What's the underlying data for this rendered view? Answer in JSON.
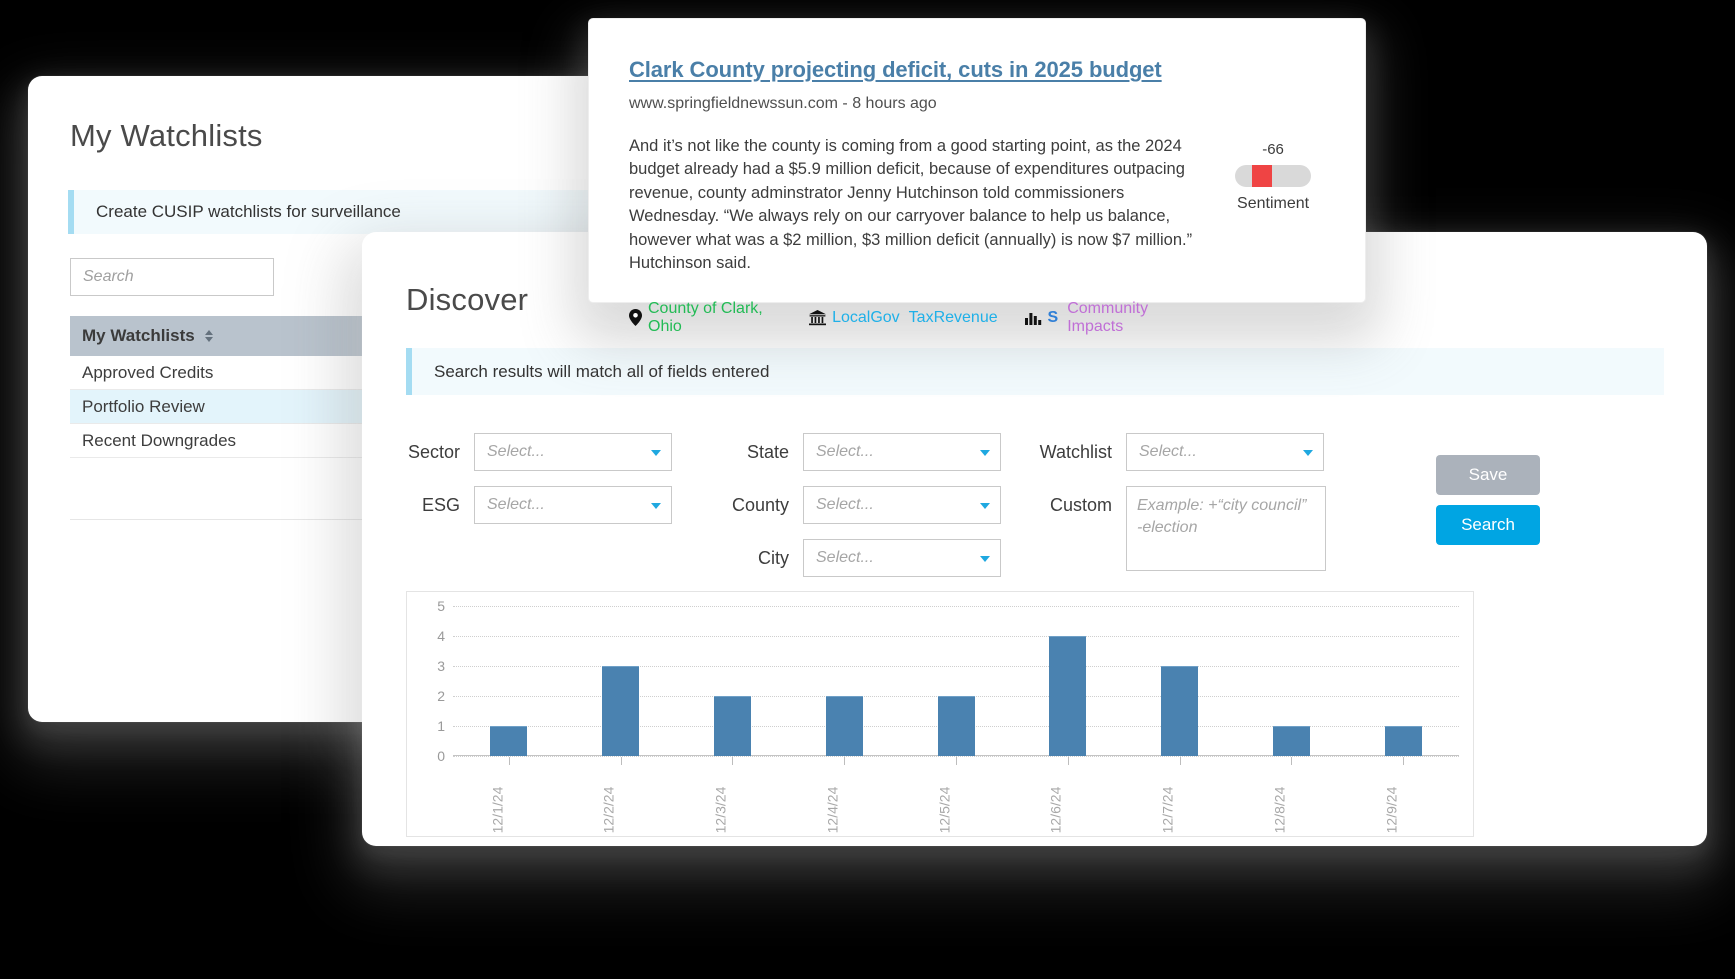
{
  "watchlists_window": {
    "title": "My Watchlists",
    "banner": "Create CUSIP watchlists for surveillance",
    "search": {
      "placeholder": "Search"
    },
    "table": {
      "header": "My Watchlists",
      "sort_icon": "sort-updown-icon",
      "rows": [
        {
          "label": "Approved Credits",
          "selected": false
        },
        {
          "label": "Portfolio Review",
          "selected": true
        },
        {
          "label": "Recent Downgrades",
          "selected": false
        }
      ]
    }
  },
  "discover_window": {
    "title": "Discover",
    "banner": "Search results will match all of fields entered",
    "fields": [
      {
        "key": "sector",
        "label": "Sector",
        "value": "",
        "placeholder": "Select...",
        "type": "select"
      },
      {
        "key": "esg",
        "label": "ESG",
        "value": "",
        "placeholder": "Select...",
        "type": "select"
      },
      {
        "key": "state",
        "label": "State",
        "value": "",
        "placeholder": "Select...",
        "type": "select"
      },
      {
        "key": "county",
        "label": "County",
        "value": "",
        "placeholder": "Select...",
        "type": "select"
      },
      {
        "key": "city",
        "label": "City",
        "value": "",
        "placeholder": "Select...",
        "type": "select"
      },
      {
        "key": "watchlist",
        "label": "Watchlist",
        "value": "",
        "placeholder": "Select...",
        "type": "select"
      },
      {
        "key": "custom",
        "label": "Custom",
        "value": "",
        "placeholder": "Example: +“city council” -election",
        "type": "textarea"
      }
    ],
    "buttons": {
      "save": "Save",
      "search": "Search",
      "save_color": "#abb2bb",
      "search_color": "#00a5e3"
    }
  },
  "news_card": {
    "headline": "Clark County projecting deficit, cuts in 2025 budget",
    "source": "www.springfieldnewssun.com - 8 hours ago",
    "body": "And it’s not like the county is coming from a good starting point, as the 2024 budget already had a $5.9 million deficit, because of expenditures outpacing revenue, county adminstrator Jenny Hutchinson told commissioners Wednesday. “We always rely on our carryover balance to help us balance, however what was a $2 million, $3 million deficit (annually) is now $7 million.” Hutchinson said.",
    "tags": [
      {
        "icon": "location-pin-icon",
        "label": "County of Clark, Ohio",
        "color": "#22bb55"
      },
      {
        "icon": "bank-icon",
        "label": "LocalGov",
        "color": "#1fb0e8"
      },
      {
        "icon": "",
        "label": "TaxRevenue",
        "color": "#1fb0e8"
      },
      {
        "icon": "bar-chart-icon",
        "label": "S",
        "color": "#2f7fd6"
      },
      {
        "icon": "",
        "label": "Community Impacts",
        "color": "#c06fd6"
      }
    ],
    "sentiment": {
      "value": "-66",
      "label": "Sentiment",
      "fill_color": "#ef4444",
      "track_color": "#d9d9d9"
    }
  },
  "chart_data": {
    "type": "bar",
    "categories": [
      "12/1/24",
      "12/2/24",
      "12/3/24",
      "12/4/24",
      "12/5/24",
      "12/6/24",
      "12/7/24",
      "12/8/24",
      "12/9/24"
    ],
    "values": [
      1,
      3,
      2,
      2,
      2,
      4,
      3,
      1,
      1
    ],
    "title": "",
    "xlabel": "",
    "ylabel": "",
    "ylim": [
      0,
      5
    ],
    "yticks": [
      0,
      1,
      2,
      3,
      4,
      5
    ],
    "grid": true,
    "legend": false,
    "bar_color": "#4a82b0"
  }
}
